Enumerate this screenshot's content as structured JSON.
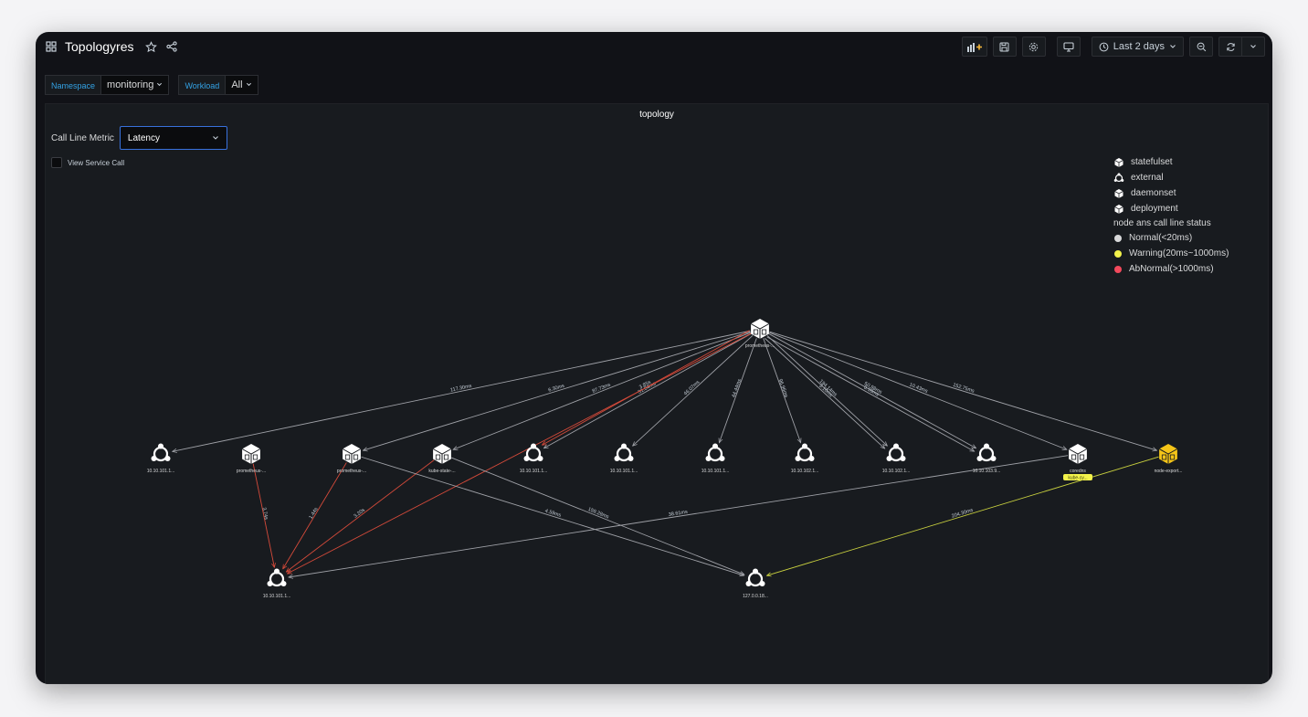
{
  "header": {
    "title": "Topologyres",
    "time_range": "Last 2 days"
  },
  "variables": [
    {
      "label": "Namespace",
      "value": "monitoring"
    },
    {
      "label": "Workload",
      "value": "All"
    }
  ],
  "panel": {
    "title": "topology",
    "metric_label": "Call Line Metric",
    "metric_value": "Latency",
    "view_service_call": "View Service Call"
  },
  "legend": {
    "types": [
      "statefulset",
      "external",
      "daemonset",
      "deployment"
    ],
    "status_title": "node ans call line status",
    "statuses": [
      {
        "label": "Normal(<20ms)",
        "color": "#d8d9da"
      },
      {
        "label": "Warning(20ms~1000ms)",
        "color": "#f2f24b"
      },
      {
        "label": "AbNormal(>1000ms)",
        "color": "#f2495c"
      }
    ]
  },
  "colors": {
    "normal": "#9fa1a7",
    "warning": "#c9d13f",
    "abnormal": "#d44a3a",
    "accent": "#33a2e5",
    "warning_node": "#f5c518"
  },
  "graph": {
    "nodes": [
      {
        "id": "prom",
        "label": "prometheus-...",
        "type": "statefulset"
      },
      {
        "id": "e1",
        "label": "10.10.101.1...",
        "type": "external"
      },
      {
        "id": "p2",
        "label": "prometheus-...",
        "type": "deployment"
      },
      {
        "id": "p3",
        "label": "prometheus-...",
        "type": "deployment"
      },
      {
        "id": "ks",
        "label": "kube-state-...",
        "type": "deployment"
      },
      {
        "id": "e2",
        "label": "10.10.101.1...",
        "type": "external"
      },
      {
        "id": "e3",
        "label": "10.10.101.1...",
        "type": "external"
      },
      {
        "id": "e4",
        "label": "10.10.101.1...",
        "type": "external"
      },
      {
        "id": "e5",
        "label": "10.10.102.1...",
        "type": "external"
      },
      {
        "id": "e6",
        "label": "10.10.102.1...",
        "type": "external"
      },
      {
        "id": "e7",
        "label": "10.10.103.9...",
        "type": "external"
      },
      {
        "id": "cd",
        "label": "coredns",
        "type": "deployment",
        "badge": "kube-sy..."
      },
      {
        "id": "ne",
        "label": "node-export...",
        "type": "daemonset",
        "status": "warning"
      },
      {
        "id": "eb1",
        "label": "10.10.101.1...",
        "type": "external"
      },
      {
        "id": "eb2",
        "label": "127.0.0.18...",
        "type": "external"
      }
    ],
    "edges": [
      {
        "from": "prom",
        "to": "e1",
        "label": "117.30ms",
        "status": "normal"
      },
      {
        "from": "prom",
        "to": "p3",
        "label": "6.30ms",
        "status": "normal"
      },
      {
        "from": "prom",
        "to": "ks",
        "label": "87.73ms",
        "status": "normal"
      },
      {
        "from": "prom",
        "to": "e2",
        "label": "31.04ms",
        "status": "normal"
      },
      {
        "from": "prom",
        "to": "e3",
        "label": "46.07ms",
        "status": "normal"
      },
      {
        "from": "prom",
        "to": "e4",
        "label": "44.44ms",
        "status": "normal"
      },
      {
        "from": "prom",
        "to": "e5",
        "label": "96.96ms",
        "status": "normal"
      },
      {
        "from": "prom",
        "to": "e6",
        "label": "194.14ms",
        "status": "normal"
      },
      {
        "from": "prom",
        "to": "e6",
        "label": "3.10ms",
        "status": "normal"
      },
      {
        "from": "prom",
        "to": "e7",
        "label": "50.98ms",
        "status": "normal"
      },
      {
        "from": "prom",
        "to": "e7",
        "label": "0.59ms",
        "status": "normal"
      },
      {
        "from": "prom",
        "to": "cd",
        "label": "10.43ms",
        "status": "normal"
      },
      {
        "from": "prom",
        "to": "ne",
        "label": "152.75ms",
        "status": "normal"
      },
      {
        "from": "prom",
        "to": "e2",
        "label": "3.85s",
        "status": "abnormal"
      },
      {
        "from": "prom",
        "to": "eb1",
        "label": "",
        "status": "abnormal"
      },
      {
        "from": "p2",
        "to": "eb1",
        "label": "3.74s",
        "status": "abnormal"
      },
      {
        "from": "p3",
        "to": "eb1",
        "label": "1.44s",
        "status": "abnormal"
      },
      {
        "from": "ks",
        "to": "eb1",
        "label": "3.20s",
        "status": "abnormal"
      },
      {
        "from": "p3",
        "to": "eb2",
        "label": "4.59ms",
        "status": "normal"
      },
      {
        "from": "ks",
        "to": "eb2",
        "label": "159.28ms",
        "status": "normal"
      },
      {
        "from": "cd",
        "to": "eb1",
        "label": "38.61ms",
        "status": "normal"
      },
      {
        "from": "ne",
        "to": "eb2",
        "label": "204.30ms",
        "status": "warning"
      }
    ]
  }
}
